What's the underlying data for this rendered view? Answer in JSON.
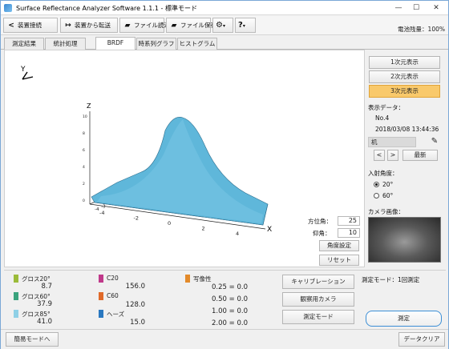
{
  "window": {
    "title": "Surface Reflectance Analyzer Software 1.1.1 - 標準モード",
    "minimize": "—",
    "maximize": "☐",
    "close": "✕"
  },
  "toolbar": {
    "connect_label": "装置接続",
    "transfer_label": "装置から転送",
    "file_read_label": "ファイル読込",
    "file_save_label": "ファイル保存",
    "battery": "電池残量：100%"
  },
  "tabs": [
    {
      "label": "測定結果"
    },
    {
      "label": "統計処理"
    },
    {
      "label": "BRDF"
    },
    {
      "label": "時系列グラフ"
    },
    {
      "label": "ヒストグラム"
    }
  ],
  "plot": {
    "z_axis_label": "Z",
    "x_axis_label": "X",
    "y_axis_label": "Y",
    "x_ticks": [
      "-4",
      "-2",
      "0",
      "2",
      "4"
    ],
    "y_ticks": [
      "-4",
      "-3",
      "-2",
      "-1",
      "0",
      "1",
      "2",
      "3",
      "4"
    ],
    "z_ticks": [
      "10",
      "8",
      "6",
      "4",
      "2",
      "0"
    ],
    "azimuth_label": "方位角：",
    "azimuth_value": "25",
    "elevation_label": "仰角：",
    "elevation_value": "10",
    "angle_set_label": "角度設定",
    "reset_label": "リセット"
  },
  "right_panel": {
    "view_1d": "1次元表示",
    "view_2d": "2次元表示",
    "view_3d": "3次元表示",
    "display_data_label": "表示データ：",
    "data_number": "No.4",
    "data_datetime": "2018/03/08 13:44:36",
    "data_name": "机",
    "prev_label": "<",
    "next_label": ">",
    "latest_label": "最新",
    "incident_label": "入射角度：",
    "incident_options": [
      "20°",
      "60°"
    ],
    "incident_selected": "20°",
    "camera_label": "カメラ画像："
  },
  "results": {
    "gloss20_label": "グロス20°",
    "gloss20_value": "8.7",
    "gloss60_label": "グロス60°",
    "gloss60_value": "37.9",
    "gloss85_label": "グロス85°",
    "gloss85_value": "41.0",
    "c20_label": "C20",
    "c20_value": "156.0",
    "c60_label": "C60",
    "c60_value": "128.0",
    "haze_label": "ヘーズ",
    "haze_value": "15.0",
    "doi_label": "写像性",
    "doi_rows": [
      "0.25 = 0.0",
      "0.50 = 0.0",
      "1.00 = 0.0",
      "2.00 = 0.0"
    ],
    "colors": {
      "gloss20": "#9bbb3a",
      "gloss60": "#3aa37d",
      "gloss85": "#8fd0e6",
      "c20": "#c0398a",
      "c60": "#e06a2a",
      "haze": "#2a78c0",
      "doi": "#e38a2a"
    }
  },
  "controls": {
    "calibration_label": "キャリブレーション",
    "observe_camera_label": "観察用カメラ",
    "measure_mode_label": "測定モード",
    "measure_mode_status": "測定モード：1回測定",
    "measure_label": "測定"
  },
  "footer": {
    "simple_mode_label": "簡易モードへ",
    "data_clear_label": "データクリア"
  },
  "surface_color": "#5fb7da"
}
